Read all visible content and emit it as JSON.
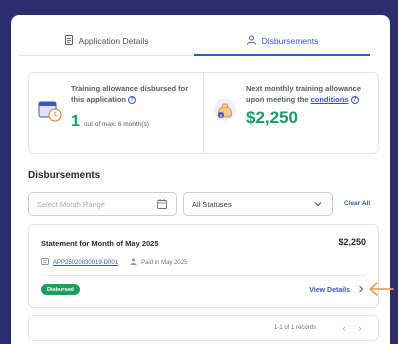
{
  "tabs": [
    {
      "label": "Application Details",
      "icon": "document-icon",
      "active": false
    },
    {
      "label": "Disbursements",
      "icon": "people-icon",
      "active": true
    }
  ],
  "summary": {
    "left": {
      "label": "Training allowance disbursed for this application",
      "count": "1",
      "count_suffix": "out of max. 6 month(s)",
      "icon": "calendar-clock-icon"
    },
    "right": {
      "label_prefix": "Next monthly training allowance upon meeting the",
      "label_link": "conditions",
      "amount": "$2,250",
      "icon": "money-bag-icon"
    }
  },
  "section_title": "Disbursements",
  "filters": {
    "month_placeholder": "Select Month Range",
    "status_value": "All Statuses",
    "clear_all": "Clear All"
  },
  "statement": {
    "title": "Statement for Month of May 2025",
    "amount": "$2,250",
    "application_id": "APP25020830019-D001",
    "paid_text": "Paid in May 2025",
    "status_badge": "Disbursed",
    "view_details": "View Details"
  },
  "pager": {
    "text": "1-1 of 1 records"
  },
  "colors": {
    "accent": "#3a56c4",
    "green": "#1a9a6a",
    "badge": "#1e9e5a",
    "annotation": "#f0a060"
  }
}
